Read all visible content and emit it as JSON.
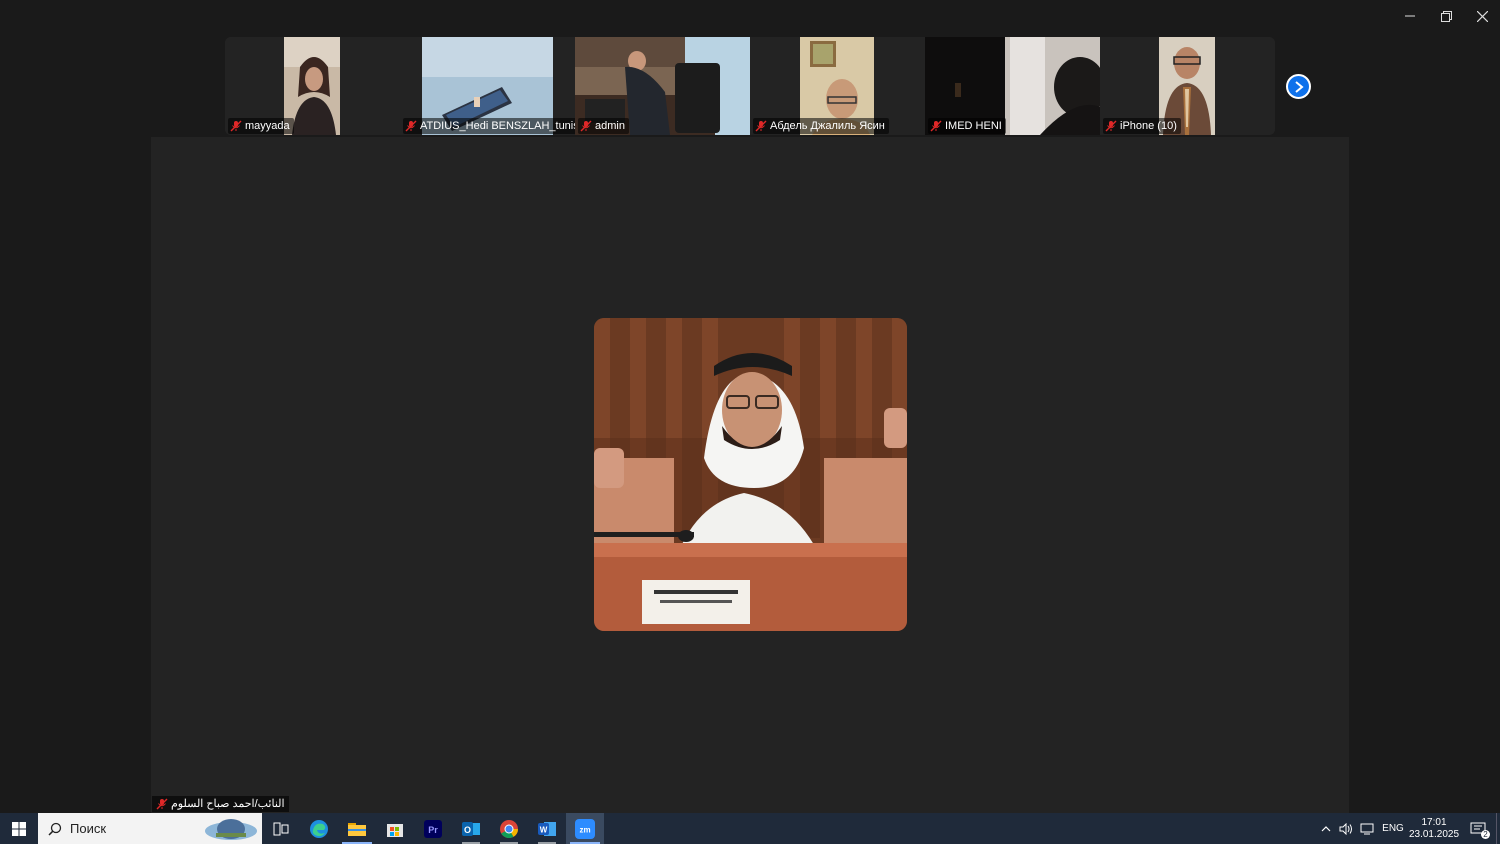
{
  "window": {
    "controls": [
      "minimize",
      "restore",
      "close"
    ]
  },
  "participants": [
    {
      "name": "mayyada",
      "muted": true
    },
    {
      "name": "ATDIUS_Hedi BENSZLAH_tunis",
      "muted": true
    },
    {
      "name": "admin",
      "muted": true
    },
    {
      "name": "Абдель Джалиль Ясин",
      "muted": true
    },
    {
      "name": "IMED HENI",
      "muted": true
    },
    {
      "name": "iPhone (10)",
      "muted": true
    }
  ],
  "active_speaker": {
    "name": "النائب/احمد صباح السلوم",
    "muted": true
  },
  "taskbar": {
    "search_placeholder": "Поиск",
    "apps": [
      "task-view",
      "edge",
      "file-explorer",
      "microsoft-store",
      "premiere-pro",
      "outlook",
      "chrome",
      "word",
      "zoom"
    ],
    "language": "ENG",
    "time": "17:01",
    "date": "23.01.2025",
    "notifications_count": "2"
  },
  "colors": {
    "accent": "#0e71eb",
    "muted_icon": "#e02828",
    "stage_bg": "#232323",
    "taskbar_bg": "#1f2a3a"
  }
}
